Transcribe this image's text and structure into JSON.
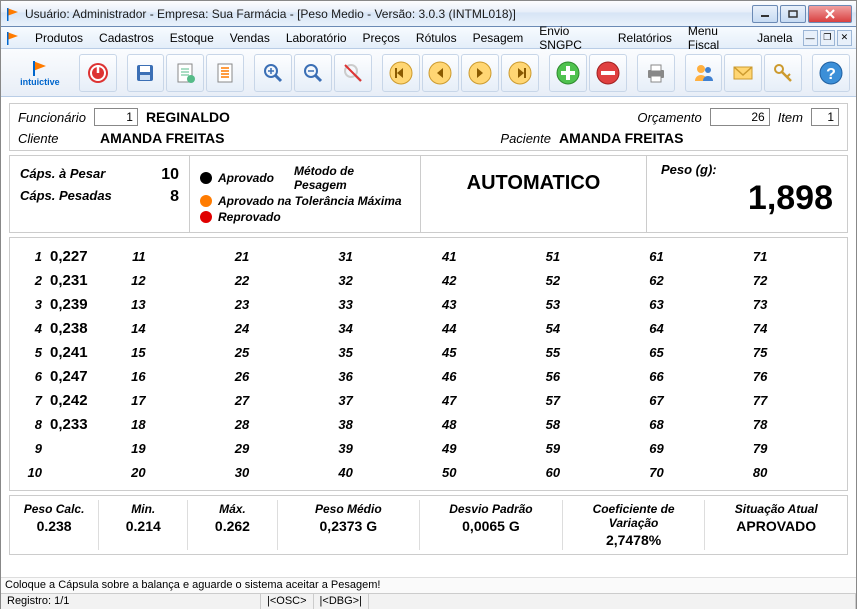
{
  "window": {
    "title": "Usuário: Administrador - Empresa: Sua Farmácia - [Peso Medio - Versão: 3.0.3 (INTML018)]"
  },
  "menu": {
    "items": [
      "Produtos",
      "Cadastros",
      "Estoque",
      "Vendas",
      "Laboratório",
      "Preços",
      "Rótulos",
      "Pesagem",
      "Envio SNGPC",
      "Relatórios",
      "Menu Fiscal",
      "Janela"
    ]
  },
  "logo_text": "intuictive",
  "header": {
    "funcionario_label": "Funcionário",
    "funcionario_id": "1",
    "funcionario_name": "REGINALDO",
    "orcamento_label": "Orçamento",
    "orcamento_value": "26",
    "item_label": "Item",
    "item_value": "1",
    "cliente_label": "Cliente",
    "cliente_name": "AMANDA FREITAS",
    "paciente_label": "Paciente",
    "paciente_name": "AMANDA FREITAS"
  },
  "info": {
    "caps_pesar_label": "Cáps. à Pesar",
    "caps_pesar_value": "10",
    "caps_pesadas_label": "Cáps. Pesadas",
    "caps_pesadas_value": "8",
    "legend_approved": "Aprovado",
    "legend_tolerance": "Aprovado na Tolerância Máxima",
    "legend_rejected": "Reprovado",
    "metodo_label": "Método de Pesagem",
    "metodo_value": "AUTOMATICO",
    "peso_label": "Peso (g):",
    "peso_value": "1,898"
  },
  "measurements": [
    {
      "idx": "1",
      "val": "0,227"
    },
    {
      "idx": "2",
      "val": "0,231"
    },
    {
      "idx": "3",
      "val": "0,239"
    },
    {
      "idx": "4",
      "val": "0,238"
    },
    {
      "idx": "5",
      "val": "0,241"
    },
    {
      "idx": "6",
      "val": "0,247"
    },
    {
      "idx": "7",
      "val": "0,242"
    },
    {
      "idx": "8",
      "val": "0,233"
    },
    {
      "idx": "9",
      "val": ""
    },
    {
      "idx": "10",
      "val": ""
    },
    {
      "idx": "11",
      "val": ""
    },
    {
      "idx": "12",
      "val": ""
    },
    {
      "idx": "13",
      "val": ""
    },
    {
      "idx": "14",
      "val": ""
    },
    {
      "idx": "15",
      "val": ""
    },
    {
      "idx": "16",
      "val": ""
    },
    {
      "idx": "17",
      "val": ""
    },
    {
      "idx": "18",
      "val": ""
    },
    {
      "idx": "19",
      "val": ""
    },
    {
      "idx": "20",
      "val": ""
    },
    {
      "idx": "21",
      "val": ""
    },
    {
      "idx": "22",
      "val": ""
    },
    {
      "idx": "23",
      "val": ""
    },
    {
      "idx": "24",
      "val": ""
    },
    {
      "idx": "25",
      "val": ""
    },
    {
      "idx": "26",
      "val": ""
    },
    {
      "idx": "27",
      "val": ""
    },
    {
      "idx": "28",
      "val": ""
    },
    {
      "idx": "29",
      "val": ""
    },
    {
      "idx": "30",
      "val": ""
    },
    {
      "idx": "31",
      "val": ""
    },
    {
      "idx": "32",
      "val": ""
    },
    {
      "idx": "33",
      "val": ""
    },
    {
      "idx": "34",
      "val": ""
    },
    {
      "idx": "35",
      "val": ""
    },
    {
      "idx": "36",
      "val": ""
    },
    {
      "idx": "37",
      "val": ""
    },
    {
      "idx": "38",
      "val": ""
    },
    {
      "idx": "39",
      "val": ""
    },
    {
      "idx": "40",
      "val": ""
    },
    {
      "idx": "41",
      "val": ""
    },
    {
      "idx": "42",
      "val": ""
    },
    {
      "idx": "43",
      "val": ""
    },
    {
      "idx": "44",
      "val": ""
    },
    {
      "idx": "45",
      "val": ""
    },
    {
      "idx": "46",
      "val": ""
    },
    {
      "idx": "47",
      "val": ""
    },
    {
      "idx": "48",
      "val": ""
    },
    {
      "idx": "49",
      "val": ""
    },
    {
      "idx": "50",
      "val": ""
    },
    {
      "idx": "51",
      "val": ""
    },
    {
      "idx": "52",
      "val": ""
    },
    {
      "idx": "53",
      "val": ""
    },
    {
      "idx": "54",
      "val": ""
    },
    {
      "idx": "55",
      "val": ""
    },
    {
      "idx": "56",
      "val": ""
    },
    {
      "idx": "57",
      "val": ""
    },
    {
      "idx": "58",
      "val": ""
    },
    {
      "idx": "59",
      "val": ""
    },
    {
      "idx": "60",
      "val": ""
    },
    {
      "idx": "61",
      "val": ""
    },
    {
      "idx": "62",
      "val": ""
    },
    {
      "idx": "63",
      "val": ""
    },
    {
      "idx": "64",
      "val": ""
    },
    {
      "idx": "65",
      "val": ""
    },
    {
      "idx": "66",
      "val": ""
    },
    {
      "idx": "67",
      "val": ""
    },
    {
      "idx": "68",
      "val": ""
    },
    {
      "idx": "69",
      "val": ""
    },
    {
      "idx": "70",
      "val": ""
    },
    {
      "idx": "71",
      "val": ""
    },
    {
      "idx": "72",
      "val": ""
    },
    {
      "idx": "73",
      "val": ""
    },
    {
      "idx": "74",
      "val": ""
    },
    {
      "idx": "75",
      "val": ""
    },
    {
      "idx": "76",
      "val": ""
    },
    {
      "idx": "77",
      "val": ""
    },
    {
      "idx": "78",
      "val": ""
    },
    {
      "idx": "79",
      "val": ""
    },
    {
      "idx": "80",
      "val": ""
    }
  ],
  "stats": {
    "peso_calc_label": "Peso Calc.",
    "peso_calc_value": "0.238",
    "min_label": "Min.",
    "min_value": "0.214",
    "max_label": "Máx.",
    "max_value": "0.262",
    "peso_medio_label": "Peso Médio",
    "peso_medio_value": "0,2373 G",
    "desvio_label": "Desvio Padrão",
    "desvio_value": "0,0065 G",
    "coef_label": "Coeficiente de Variação",
    "coef_value": "2,7478%",
    "situacao_label": "Situação Atual",
    "situacao_value": "APROVADO"
  },
  "footer": {
    "message": "Coloque a Cápsula sobre a balança e aguarde o sistema aceitar a Pesagem!",
    "registro": "Registro: 1/1",
    "osc": "|<OSC>",
    "dbg": "|<DBG>|"
  }
}
